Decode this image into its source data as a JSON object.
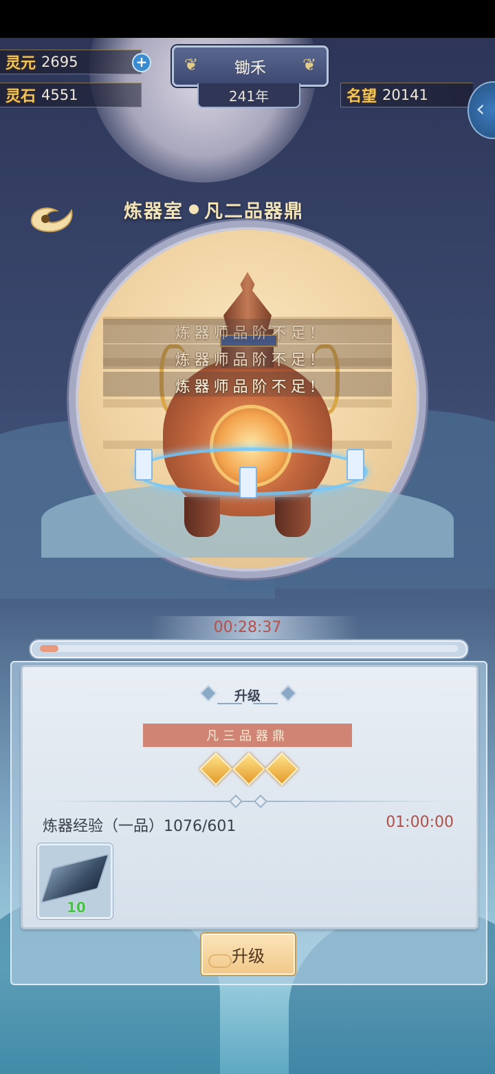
{
  "resources": [
    {
      "label": "灵元",
      "value": "2695"
    },
    {
      "label": "灵石",
      "value": "4551"
    },
    {
      "label": "名望",
      "value": "20141"
    }
  ],
  "player": {
    "name": "锄禾",
    "year": "241年"
  },
  "header": {
    "room": "炼器室",
    "cauldron": "凡二品器鼎"
  },
  "messages": [
    "炼器师品阶不足!",
    "炼器师品阶不足!",
    "炼器师品阶不足!"
  ],
  "timer": "00:28:37",
  "progress": 0.045,
  "upgrade": {
    "section_title": "升级",
    "next_tier": "凡三品器鼎",
    "stars": 3,
    "requirement_label": "炼器经验（一品）1076/601",
    "requirement_time": "01:00:00",
    "material_qty": "10",
    "button_label": "升级"
  },
  "colors": {
    "gold": "#f1c75a",
    "timer_red": "#b4514b",
    "tier_bar": "#cf8474",
    "qty_green": "#48c04a"
  },
  "icons": [
    "plus-icon",
    "back-swirl-icon",
    "side-arrow-icon",
    "ingot-icon",
    "star-icon"
  ]
}
